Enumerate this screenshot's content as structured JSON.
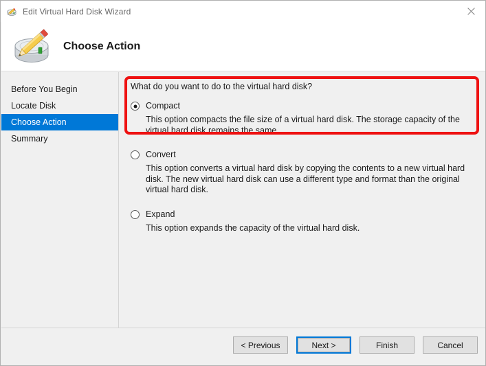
{
  "window": {
    "title": "Edit Virtual Hard Disk Wizard",
    "title_icon": "disk-pencil-icon",
    "close_icon": "close-icon",
    "accent_color": "#0078d7",
    "annotation_color": "#ee1111",
    "body_background": "#f0f0f0"
  },
  "header": {
    "icon": "virtual-hard-disk-edit-icon",
    "title": "Choose Action"
  },
  "sidebar": {
    "items": [
      {
        "label": "Before You Begin",
        "selected": false
      },
      {
        "label": "Locate Disk",
        "selected": false
      },
      {
        "label": "Choose Action",
        "selected": true
      },
      {
        "label": "Summary",
        "selected": false
      }
    ]
  },
  "main": {
    "question": "What do you want to do to the virtual hard disk?",
    "options": [
      {
        "label": "Compact",
        "checked": true,
        "description": "This option compacts the file size of a virtual hard disk. The storage capacity of the virtual hard disk remains the same."
      },
      {
        "label": "Convert",
        "checked": false,
        "description": "This option converts a virtual hard disk by copying the contents to a new virtual hard disk. The new virtual hard disk can use a different type and format than the original virtual hard disk."
      },
      {
        "label": "Expand",
        "checked": false,
        "description": "This option expands the capacity of the virtual hard disk."
      }
    ]
  },
  "footer": {
    "buttons": [
      {
        "label": "< Previous",
        "focused": false
      },
      {
        "label": "Next >",
        "focused": true
      },
      {
        "label": "Finish",
        "focused": false
      },
      {
        "label": "Cancel",
        "focused": false
      }
    ]
  }
}
